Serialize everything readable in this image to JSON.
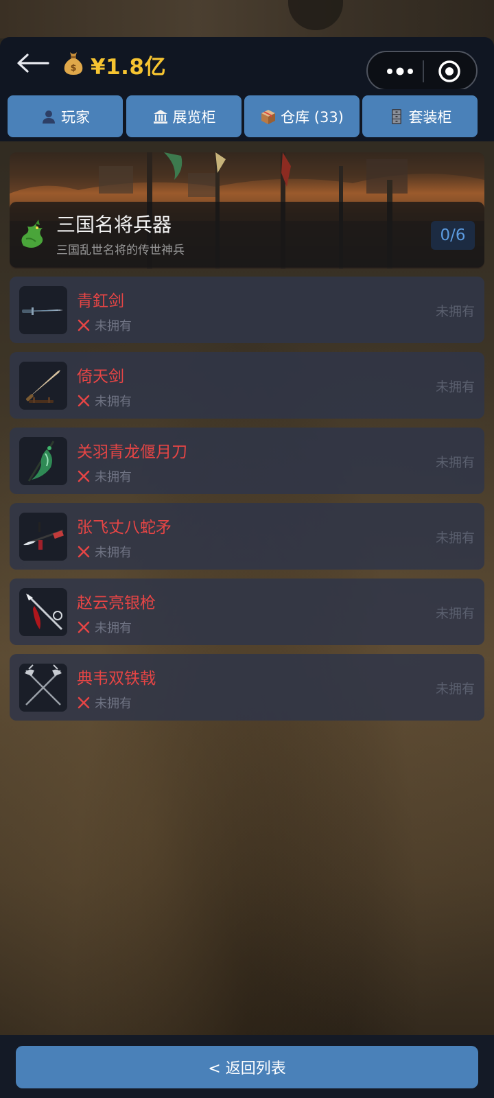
{
  "header": {
    "money": "¥1.8亿"
  },
  "tabs": [
    {
      "label": "玩家"
    },
    {
      "label": "展览柜"
    },
    {
      "label": "仓库 (33)"
    },
    {
      "label": "套装柜"
    }
  ],
  "collection": {
    "title": "三国名将兵器",
    "subtitle": "三国乱世名将的传世神兵",
    "progress": "0/6"
  },
  "items": [
    {
      "name": "青釭剑",
      "status": "未拥有",
      "right_status": "未拥有"
    },
    {
      "name": "倚天剑",
      "status": "未拥有",
      "right_status": "未拥有"
    },
    {
      "name": "关羽青龙偃月刀",
      "status": "未拥有",
      "right_status": "未拥有"
    },
    {
      "name": "张飞丈八蛇矛",
      "status": "未拥有",
      "right_status": "未拥有"
    },
    {
      "name": "赵云亮银枪",
      "status": "未拥有",
      "right_status": "未拥有"
    },
    {
      "name": "典韦双铁戟",
      "status": "未拥有",
      "right_status": "未拥有"
    }
  ],
  "footer": {
    "return_label": "< 返回列表"
  },
  "colors": {
    "accent": "#4a81b9",
    "money": "#f6c431",
    "item_name": "#e64545",
    "progress": "#5c9be0"
  },
  "icons": {
    "back": "back-arrow-icon",
    "coin": "money-bag-icon",
    "more": "more-dots-icon",
    "close": "target-circle-icon",
    "player": "user-icon",
    "showcase": "museum-icon",
    "warehouse": "box-icon",
    "set": "cabinet-icon",
    "collection": "dragon-icon",
    "not_owned": "x-mark-icon"
  }
}
